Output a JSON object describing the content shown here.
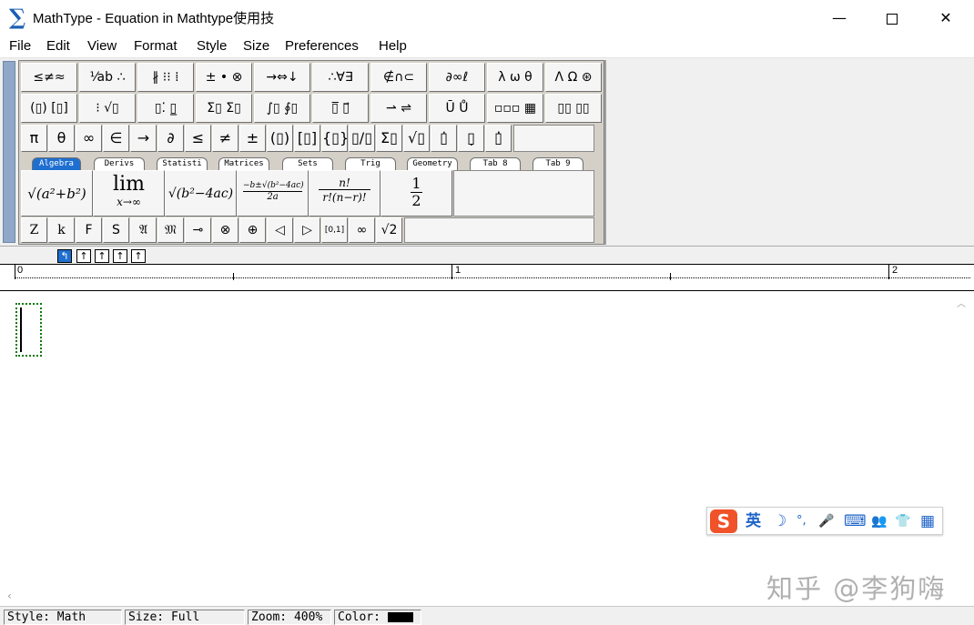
{
  "window": {
    "title": "MathType - Equation in Mathtype使用技",
    "app_icon": "∑",
    "minimize": "—",
    "close": "✕"
  },
  "menu": [
    "File",
    "Edit",
    "View",
    "Format",
    "Style",
    "Size",
    "Preferences",
    "Help"
  ],
  "palette": {
    "row1": [
      "≤≠≈",
      "⅟ab ∴",
      "∦ ⁝⁝ ⁞",
      "± • ⊗",
      "→⇔↓",
      "∴∀∃",
      "∉∩⊂",
      "∂∞ℓ",
      "λ ω θ",
      "Λ Ω ⊛"
    ],
    "row2": [
      "(▯) [▯]",
      "⁝ √▯",
      "▯⁚ ▯̲",
      "Σ▯ Σ▯",
      "∫▯ ∮▯",
      "▯̅ ▯⃗",
      "⇀ ⇌",
      "Ū Ů",
      "▫▫▫ ▦",
      "▯▯ ▯▯"
    ],
    "row3": [
      "π",
      "θ",
      "∞",
      "∈",
      "→",
      "∂",
      "≤",
      "≠",
      "±",
      "(▯)",
      "[▯]",
      "{▯}",
      "▯/▯",
      "Σ▯",
      "√▯",
      "▯̇",
      "▯̣",
      "▯̇̇"
    ],
    "tabs": [
      "Algebra",
      "Derivs",
      "Statisti",
      "Matrices",
      "Sets",
      "Trig",
      "Geometry",
      "Tab 8",
      "Tab 9"
    ],
    "templates": [
      "√(a²+b²)",
      "lim",
      "x→∞",
      "√(b²−4ac)",
      "−b±√(b²−4ac)",
      "2a",
      "n!",
      "r!(n−r)!",
      "1",
      "2"
    ],
    "row5": [
      "Z",
      "k",
      "F",
      "S",
      "𝔄",
      "𝔐",
      "⊸",
      "⊗",
      "⊕",
      "◁",
      "▷",
      "[0,1]",
      "∞",
      "√2"
    ]
  },
  "nudge": [
    "↰",
    "↑",
    "↑",
    "↑",
    "↑"
  ],
  "ruler": {
    "labels": [
      "0",
      "1",
      "2"
    ]
  },
  "ime": {
    "logo": "S",
    "mode": "英",
    "icons": [
      "moon-icon",
      "punctuation-icon",
      "microphone-icon",
      "keyboard-icon",
      "user-icon",
      "shirt-icon",
      "grid-icon"
    ],
    "glyphs": [
      "☽",
      "°,",
      "🎤",
      "⌨",
      "👥",
      "👕",
      "▦"
    ]
  },
  "watermark": "知乎 @李狗嗨",
  "status": {
    "style": "Style: Math",
    "size": "Size: Full",
    "zoom": "Zoom: 400%",
    "color_label": "Color:",
    "color_value": "#000000"
  }
}
